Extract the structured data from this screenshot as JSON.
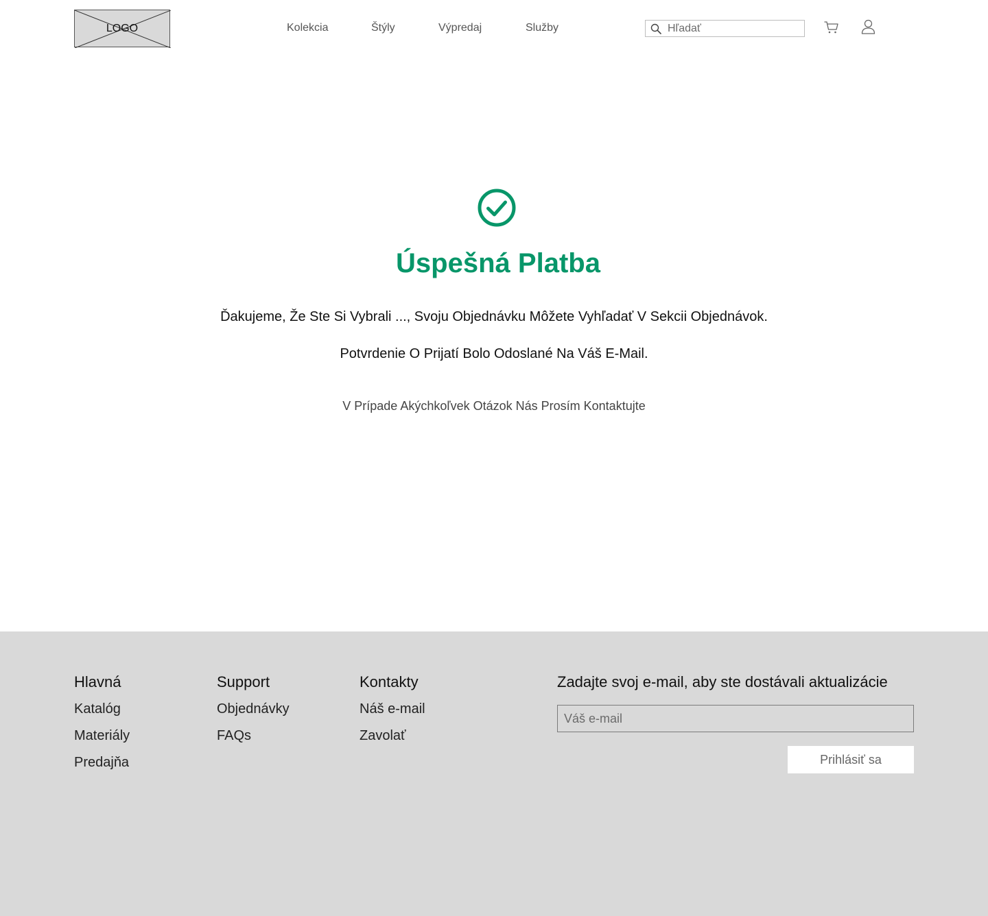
{
  "header": {
    "logo_text": "LOGO",
    "nav": [
      {
        "label": "Kolekcia"
      },
      {
        "label": "Štýly"
      },
      {
        "label": "Výpredaj"
      },
      {
        "label": "Služby"
      }
    ],
    "search_placeholder": "Hľadať",
    "icons": [
      "search-icon",
      "cart-icon",
      "user-icon"
    ]
  },
  "main": {
    "icon": "check-circle-icon",
    "title": "Úspešná Platba",
    "message_1": "Ďakujeme, Že Ste Si Vybrali ..., Svoju Objednávku Môžete Vyhľadať V Sekcii Objednávok.",
    "message_2": "Potvrdenie O Prijatí Bolo Odoslané Na Váš E-Mail.",
    "contact_note": "V Prípade Akýchkoľvek Otázok Nás Prosím Kontaktujte"
  },
  "footer": {
    "columns": [
      {
        "heading": "Hlavná",
        "links": [
          "Katalóg",
          "Materiály",
          "Predajňa"
        ]
      },
      {
        "heading": "Support",
        "links": [
          "Objednávky",
          "FAQs"
        ]
      },
      {
        "heading": "Kontakty",
        "links": [
          "Náš e-mail",
          "Zavolať"
        ]
      }
    ],
    "newsletter": {
      "heading": "Zadajte svoj e-mail, aby ste dostávali aktualizácie",
      "placeholder": "Váš e-mail",
      "button_label": "Prihlásiť sa"
    }
  },
  "colors": {
    "accent": "#089669",
    "footer_bg": "#d9d9d9"
  }
}
